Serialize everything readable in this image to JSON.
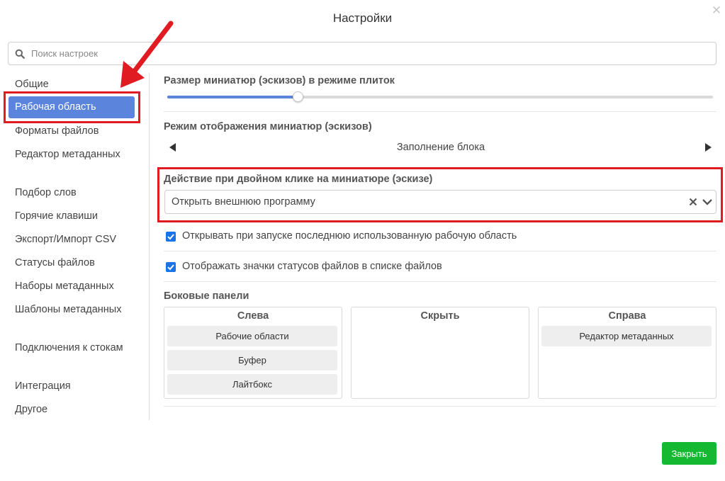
{
  "dialog": {
    "title": "Настройки"
  },
  "search": {
    "placeholder": "Поиск настроек",
    "value": ""
  },
  "sidebar": {
    "items": [
      {
        "label": "Общие"
      },
      {
        "label": "Рабочая область",
        "active": true
      },
      {
        "label": "Форматы файлов"
      },
      {
        "label": "Редактор метаданных"
      },
      {
        "label": "Подбор слов"
      },
      {
        "label": "Горячие клавиши"
      },
      {
        "label": "Экспорт/Импорт CSV"
      },
      {
        "label": "Статусы файлов"
      },
      {
        "label": "Наборы метаданных"
      },
      {
        "label": "Шаблоны метаданных"
      },
      {
        "label": "Подключения к стокам"
      },
      {
        "label": "Интеграция"
      },
      {
        "label": "Другое"
      }
    ]
  },
  "thumb_size": {
    "label": "Размер миниатюр (эскизов) в режиме плиток",
    "value_fraction": 0.24
  },
  "thumb_mode": {
    "label": "Режим отображения миниатюр (эскизов)",
    "value": "Заполнение блока"
  },
  "double_click": {
    "label": "Действие при двойном клике на миниатюре (эскизе)",
    "value": "Открыть внешнюю программу"
  },
  "checkboxes": [
    {
      "label": "Открывать при запуске последнюю использованную рабочую область",
      "checked": true
    },
    {
      "label": "Отображать значки статусов файлов в списке файлов",
      "checked": true
    }
  ],
  "side_panels": {
    "label": "Боковые панели",
    "left": {
      "title": "Слева",
      "items": [
        "Рабочие области",
        "Буфер",
        "Лайтбокс"
      ]
    },
    "hidden": {
      "title": "Скрыть",
      "items": []
    },
    "right": {
      "title": "Справа",
      "items": [
        "Редактор метаданных"
      ]
    }
  },
  "footer": {
    "close_label": "Закрыть"
  },
  "colors": {
    "accent": "#5b84dd",
    "checkbox": "#1a73e8",
    "primary_button": "#15b931",
    "annotation": "#e01b22"
  },
  "icons": {
    "search": "search-icon",
    "dialog_close": "close-icon",
    "prev": "chevron-left-icon",
    "next": "chevron-right-icon",
    "clear": "clear-icon",
    "dropdown": "chevron-down-icon",
    "check": "check-icon",
    "annotation": "red-arrow-annotation"
  }
}
